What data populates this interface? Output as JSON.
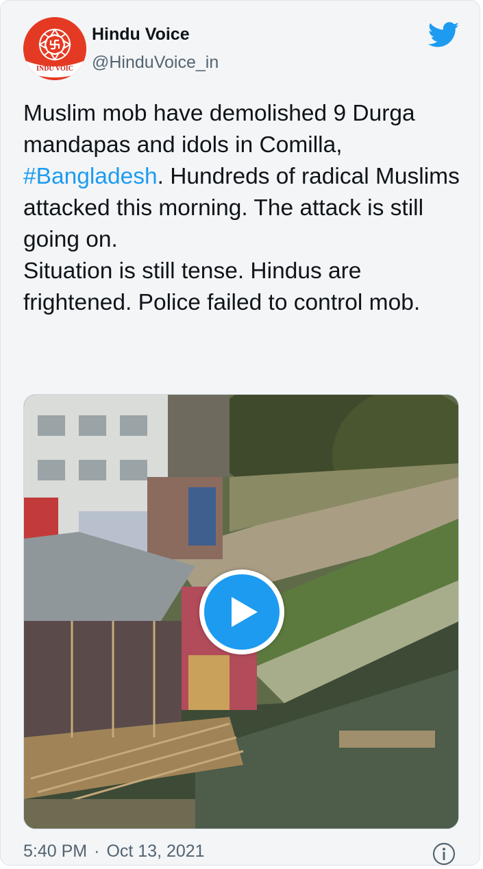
{
  "author": {
    "name": "Hindu Voice",
    "handle": "@HinduVoice_in",
    "avatar_text": "INDU VOIC"
  },
  "icons": {
    "platform": "twitter-bird-icon",
    "play": "play-icon",
    "info": "info-icon"
  },
  "tweet": {
    "text_before": "Muslim mob have demolished 9 Durga mandapas and idols in Comilla, ",
    "hashtag": "#Bangladesh",
    "text_after": ". Hundreds of radical Muslims attacked this morning. The attack is still going on.",
    "line2": "Situation is still tense. Hindus are frightened. Police failed to control mob."
  },
  "meta": {
    "time": "5:40 PM",
    "separator": "·",
    "date": "Oct 13, 2021"
  },
  "colors": {
    "accent": "#1d9bf0",
    "text": "#0f1419",
    "muted": "#536471",
    "avatar_bg": "#e43a23"
  }
}
